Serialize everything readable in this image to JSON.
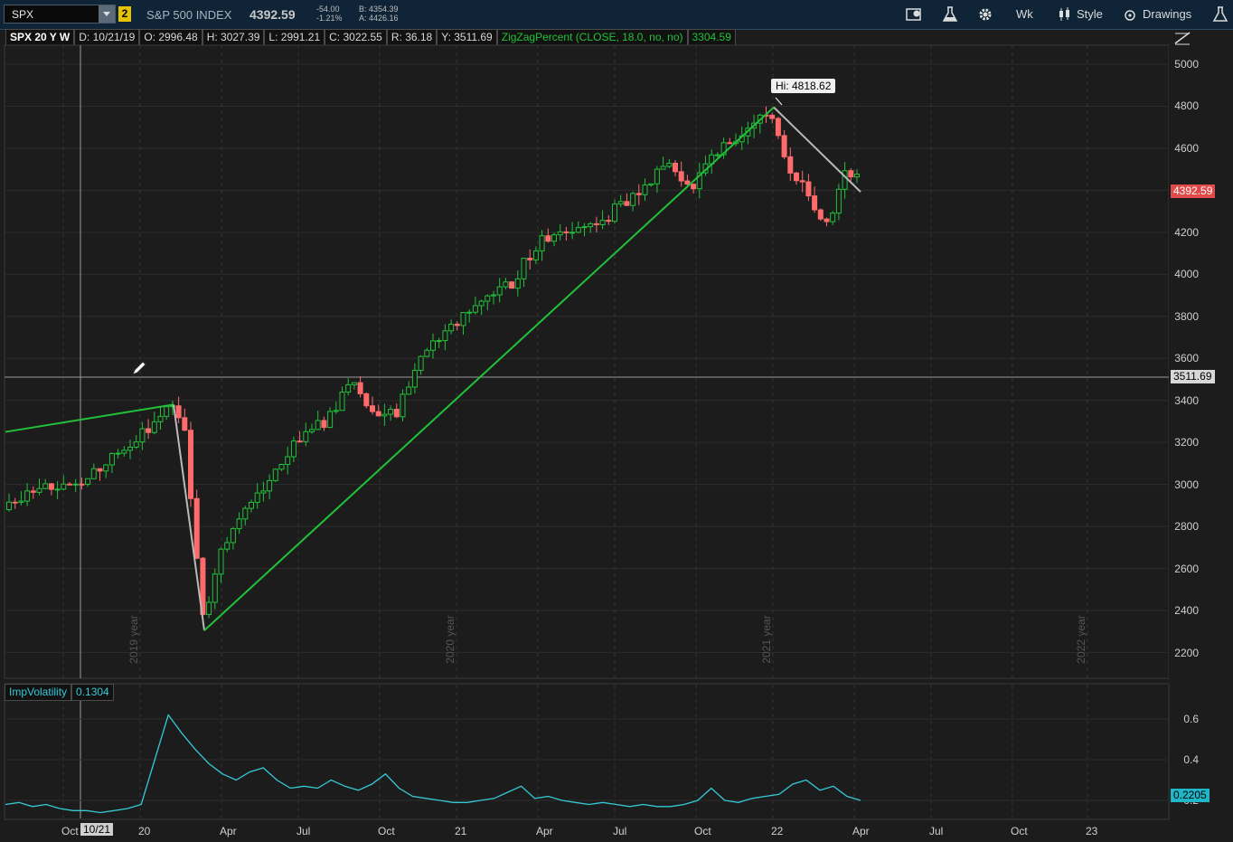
{
  "toolbar": {
    "symbol": "SPX",
    "link_badge": "2",
    "index_name": "S&P 500 INDEX",
    "last_price": "4392.59",
    "change": "-54.00",
    "change_pct": "-1.21%",
    "bid": "B: 4354.39",
    "ask": "A: 4426.16",
    "aggregation": "Wk",
    "style_label": "Style",
    "drawings_label": "Drawings"
  },
  "legend": {
    "symbol": "SPX 20 Y W",
    "date": "D: 10/21/19",
    "open": "O: 2996.48",
    "high": "H: 3027.39",
    "low": "L: 2991.21",
    "close": "C: 3022.55",
    "range": "R: 36.18",
    "cursor_y": "Y: 3511.69",
    "study": "ZigZagPercent (CLOSE, 18.0, no, no)",
    "study_value": "3304.59"
  },
  "price_axis": {
    "ticks": [
      "5000",
      "4800",
      "4600",
      "4400",
      "4200",
      "4000",
      "3800",
      "3600",
      "3400",
      "3200",
      "3000",
      "2800",
      "2600",
      "2400",
      "2200"
    ],
    "last_price_tag": "4392.59",
    "cursor_tag": "3511.69",
    "high_bubble": "Hi: 4818.62"
  },
  "year_marks": [
    "2019 year",
    "2020 year",
    "2021 year",
    "2022 year"
  ],
  "iv": {
    "label": "ImpVolatility",
    "value": "0.1304",
    "ticks": [
      "0.6",
      "0.4",
      "0.2"
    ],
    "current_tag": "0.2205"
  },
  "time_axis": {
    "labels": [
      "Oct",
      "20",
      "Apr",
      "Jul",
      "Oct",
      "21",
      "Apr",
      "Jul",
      "Oct",
      "22",
      "Apr",
      "Jul",
      "Oct",
      "23"
    ],
    "cursor_label": "10/21"
  },
  "colors": {
    "up_candle": "#21c23a",
    "down_candle": "#ff6b6b",
    "zigzag_up": "#21c23a",
    "zigzag_down": "#b9b9b9",
    "iv_line": "#35c9d8",
    "last_tag_bg": "#e24a4a"
  },
  "chart_data": {
    "type": "line",
    "title": "SPX 20 Y W",
    "ylim": [
      2150,
      5050
    ],
    "zigzag": [
      {
        "date": "2018-06",
        "value": 3250
      },
      {
        "date": "2020-02",
        "value": 3380
      },
      {
        "date": "2020-03",
        "value": 2305
      },
      {
        "date": "2022-01",
        "value": 4795
      },
      {
        "date": "2022-04",
        "value": 4392.59
      }
    ],
    "iv_series": {
      "name": "ImpVolatility",
      "ylim": [
        0.1,
        0.7
      ],
      "values": [
        0.18,
        0.19,
        0.17,
        0.18,
        0.16,
        0.15,
        0.15,
        0.14,
        0.15,
        0.16,
        0.18,
        0.4,
        0.62,
        0.53,
        0.45,
        0.38,
        0.33,
        0.3,
        0.34,
        0.36,
        0.3,
        0.26,
        0.27,
        0.26,
        0.3,
        0.27,
        0.25,
        0.28,
        0.33,
        0.26,
        0.22,
        0.21,
        0.2,
        0.19,
        0.19,
        0.2,
        0.21,
        0.24,
        0.27,
        0.21,
        0.22,
        0.2,
        0.19,
        0.18,
        0.19,
        0.18,
        0.17,
        0.18,
        0.17,
        0.17,
        0.18,
        0.2,
        0.26,
        0.2,
        0.19,
        0.21,
        0.22,
        0.23,
        0.28,
        0.3,
        0.25,
        0.27,
        0.22,
        0.2
      ]
    }
  }
}
